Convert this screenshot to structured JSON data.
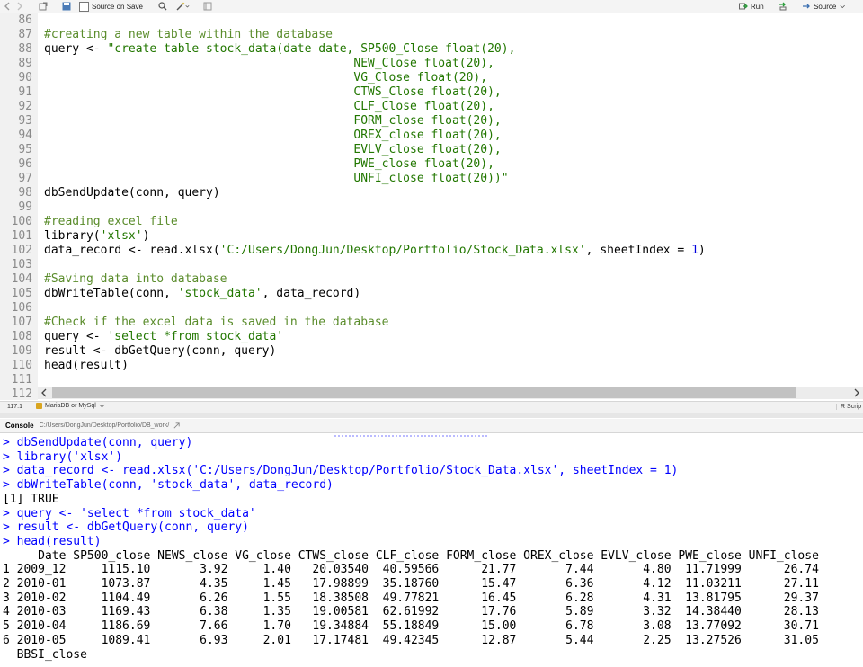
{
  "toolbar": {
    "source_on_save": "Source on Save",
    "run": "Run",
    "source": "Source"
  },
  "editor": {
    "lines": [
      {
        "n": "86",
        "t": ""
      },
      {
        "n": "87",
        "t": "#creating a new table within the database",
        "k": "cm"
      },
      {
        "n": "88",
        "t": "query <- \"create table stock_data(date date, SP500_Close float(20),",
        "k": "q1"
      },
      {
        "n": "89",
        "t": "                                            NEW_Close float(20),",
        "k": "st"
      },
      {
        "n": "90",
        "t": "                                            VG_Close float(20),",
        "k": "st"
      },
      {
        "n": "91",
        "t": "                                            CTWS_Close float(20),",
        "k": "st"
      },
      {
        "n": "92",
        "t": "                                            CLF_Close float(20),",
        "k": "st"
      },
      {
        "n": "93",
        "t": "                                            FORM_close float(20),",
        "k": "st"
      },
      {
        "n": "94",
        "t": "                                            OREX_close float(20),",
        "k": "st"
      },
      {
        "n": "95",
        "t": "                                            EVLV_close float(20),",
        "k": "st"
      },
      {
        "n": "96",
        "t": "                                            PWE_close float(20),",
        "k": "st"
      },
      {
        "n": "97",
        "t": "                                            UNFI_close float(20))\"",
        "k": "st"
      },
      {
        "n": "98",
        "t": "dbSendUpdate(conn, query)"
      },
      {
        "n": "99",
        "t": ""
      },
      {
        "n": "100",
        "t": "#reading excel file",
        "k": "cm"
      },
      {
        "n": "101",
        "t": "library('xlsx')",
        "k": "lib"
      },
      {
        "n": "102",
        "t": "data_record <- read.xlsx('C:/Users/DongJun/Desktop/Portfolio/Stock_Data.xlsx', sheetIndex = 1)",
        "k": "read"
      },
      {
        "n": "103",
        "t": ""
      },
      {
        "n": "104",
        "t": "#Saving data into database",
        "k": "cm"
      },
      {
        "n": "105",
        "t": "dbWriteTable(conn, 'stock_data', data_record)",
        "k": "write"
      },
      {
        "n": "106",
        "t": ""
      },
      {
        "n": "107",
        "t": "#Check if the excel data is saved in the database",
        "k": "cm"
      },
      {
        "n": "108",
        "t": "query <- 'select *from stock_data'",
        "k": "q2"
      },
      {
        "n": "109",
        "t": "result <- dbGetQuery(conn, query)"
      },
      {
        "n": "110",
        "t": "head(result)"
      },
      {
        "n": "111",
        "t": ""
      },
      {
        "n": "112",
        "t": ""
      }
    ]
  },
  "status": {
    "position": "117:1",
    "context": "MariaDB or MySql",
    "filetype": "R Scrip"
  },
  "console": {
    "title": "Console",
    "path": "C:/Users/DongJun/Desktop/Portfolio/DB_work/",
    "lines": [
      {
        "k": "in",
        "t": "> dbSendUpdate(conn, query)"
      },
      {
        "k": "in",
        "t": "> library('xlsx')"
      },
      {
        "k": "in",
        "t": "> data_record <- read.xlsx('C:/Users/DongJun/Desktop/Portfolio/Stock_Data.xlsx', sheetIndex = 1)"
      },
      {
        "k": "in",
        "t": "> dbWriteTable(conn, 'stock_data', data_record)"
      },
      {
        "k": "out",
        "t": "[1] TRUE"
      },
      {
        "k": "in",
        "t": "> query <- 'select *from stock_data'"
      },
      {
        "k": "in",
        "t": "> result <- dbGetQuery(conn, query)"
      },
      {
        "k": "in",
        "t": "> head(result)"
      },
      {
        "k": "out",
        "t": "     Date SP500_close NEWS_close VG_close CTWS_close CLF_close FORM_close OREX_close EVLV_close PWE_close UNFI_close"
      },
      {
        "k": "out",
        "t": "1 2009_12     1115.10       3.92     1.40   20.03540  40.59566      21.77       7.44       4.80  11.71999      26.74"
      },
      {
        "k": "out",
        "t": "2 2010-01     1073.87       4.35     1.45   17.98899  35.18760      15.47       6.36       4.12  11.03211      27.11"
      },
      {
        "k": "out",
        "t": "3 2010-02     1104.49       6.26     1.55   18.38508  49.77821      16.45       6.28       4.31  13.81795      29.37"
      },
      {
        "k": "out",
        "t": "4 2010-03     1169.43       6.38     1.35   19.00581  62.61992      17.76       5.89       3.32  14.38440      28.13"
      },
      {
        "k": "out",
        "t": "5 2010-04     1186.69       7.66     1.70   19.34884  55.18849      15.00       6.78       3.08  13.77092      30.71"
      },
      {
        "k": "out",
        "t": "6 2010-05     1089.41       6.93     2.01   17.17481  49.42345      12.87       5.44       2.25  13.27526      31.05"
      },
      {
        "k": "out",
        "t": "  BBSI_close"
      }
    ]
  }
}
